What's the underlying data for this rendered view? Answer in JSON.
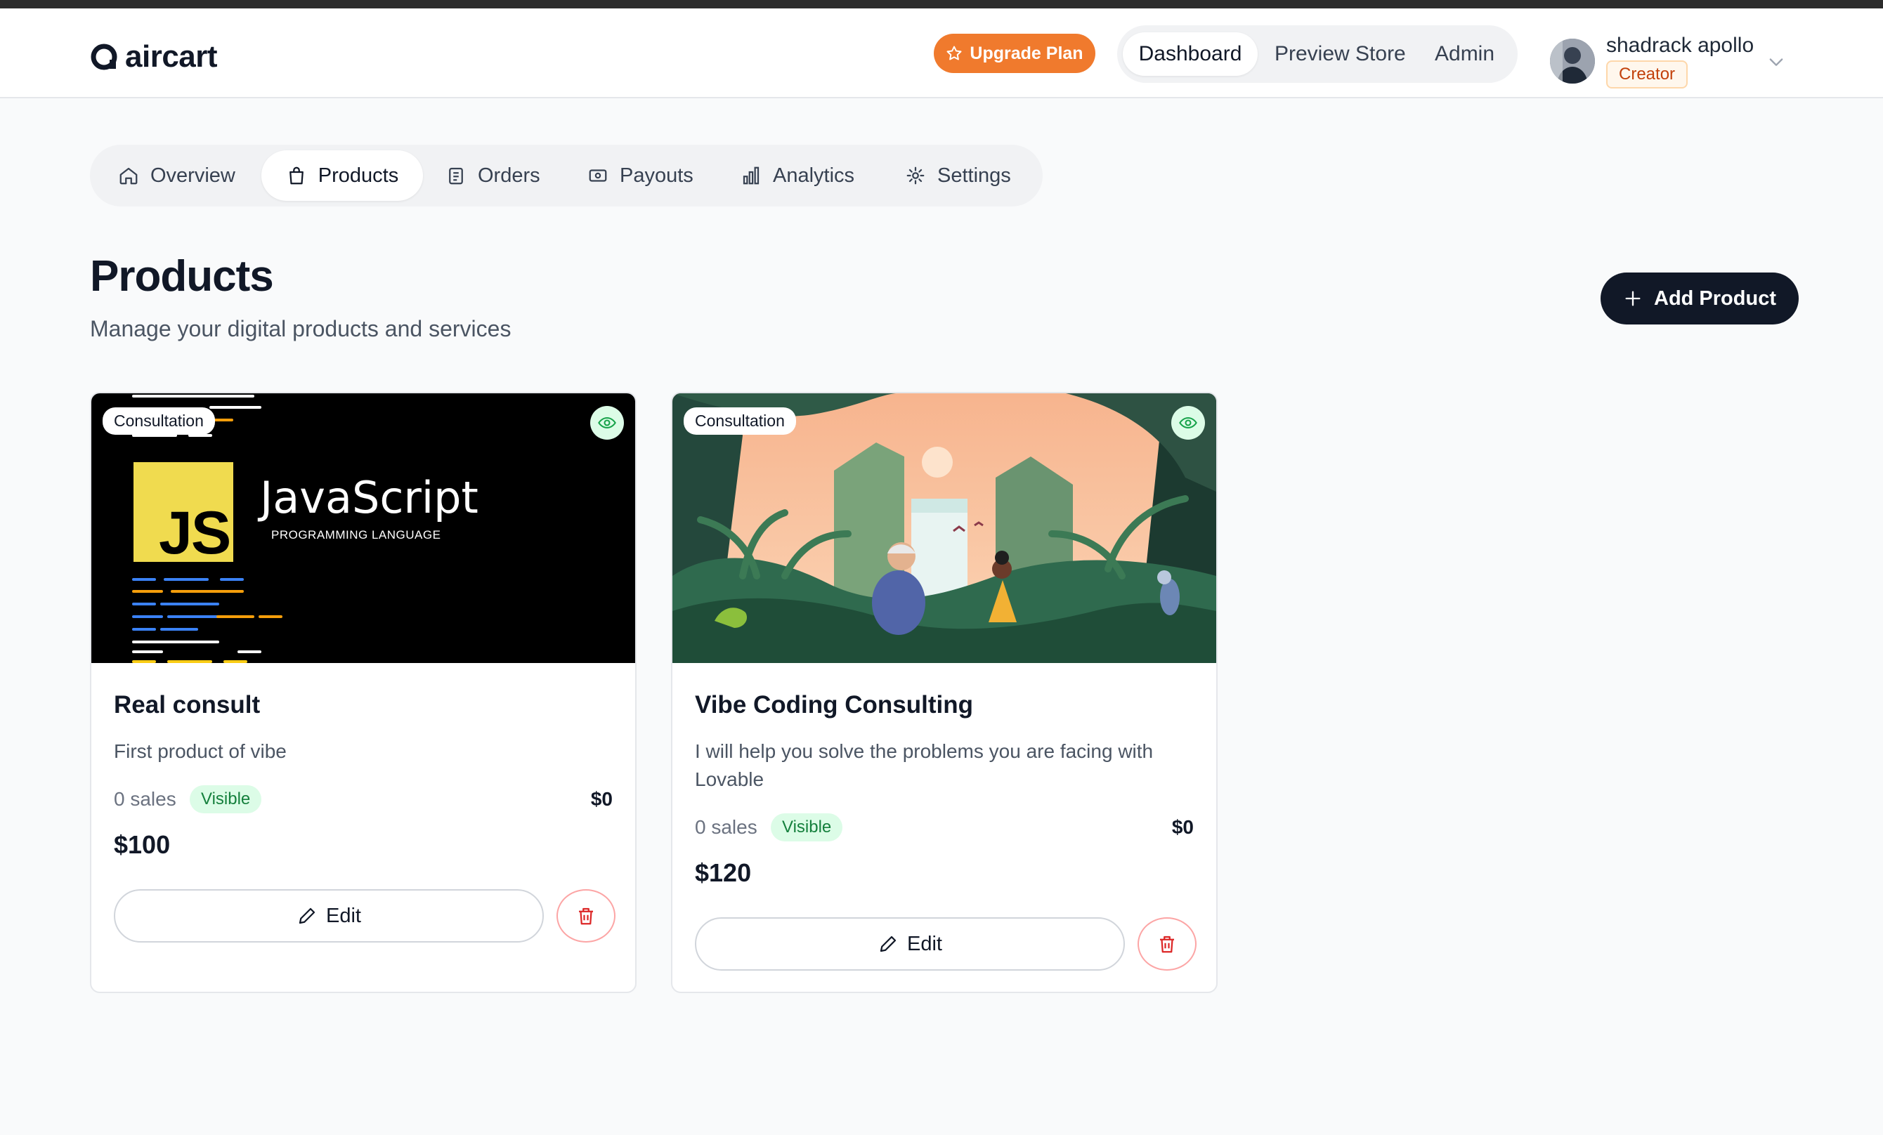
{
  "app": {
    "logo_text": "aircart"
  },
  "header": {
    "upgrade_label": "Upgrade Plan",
    "nav": [
      "Dashboard",
      "Preview Store",
      "Admin"
    ],
    "user": {
      "name": "shadrack apollo",
      "role": "Creator"
    }
  },
  "tabs": [
    "Overview",
    "Products",
    "Orders",
    "Payouts",
    "Analytics",
    "Settings"
  ],
  "page": {
    "title": "Products",
    "subtitle": "Manage your digital products and services",
    "add_label": "Add Product"
  },
  "products": [
    {
      "category": "Consultation",
      "image_text": {
        "title": "JavaScript",
        "subtitle": "PROGRAMMING LANGUAGE",
        "logo": "JS"
      },
      "title": "Real consult",
      "description": "First product of vibe",
      "sales": "0 sales",
      "status": "Visible",
      "revenue": "$0",
      "price": "$100",
      "edit_label": "Edit"
    },
    {
      "category": "Consultation",
      "title": "Vibe Coding Consulting",
      "description": "I will help you solve the problems you are facing with Lovable",
      "sales": "0 sales",
      "status": "Visible",
      "revenue": "$0",
      "price": "$120",
      "edit_label": "Edit"
    }
  ],
  "colors": {
    "accent": "#f07a2d",
    "primary": "#111827",
    "visible_bg": "#dcfce7",
    "visible_text": "#15803d",
    "danger": "#dc2626"
  },
  "icons": [
    "star-icon",
    "home-icon",
    "bag-icon",
    "clipboard-icon",
    "cash-icon",
    "bar-chart-icon",
    "gear-icon",
    "plus-icon",
    "eye-icon",
    "pencil-icon",
    "trash-icon",
    "chevron-down-icon"
  ]
}
